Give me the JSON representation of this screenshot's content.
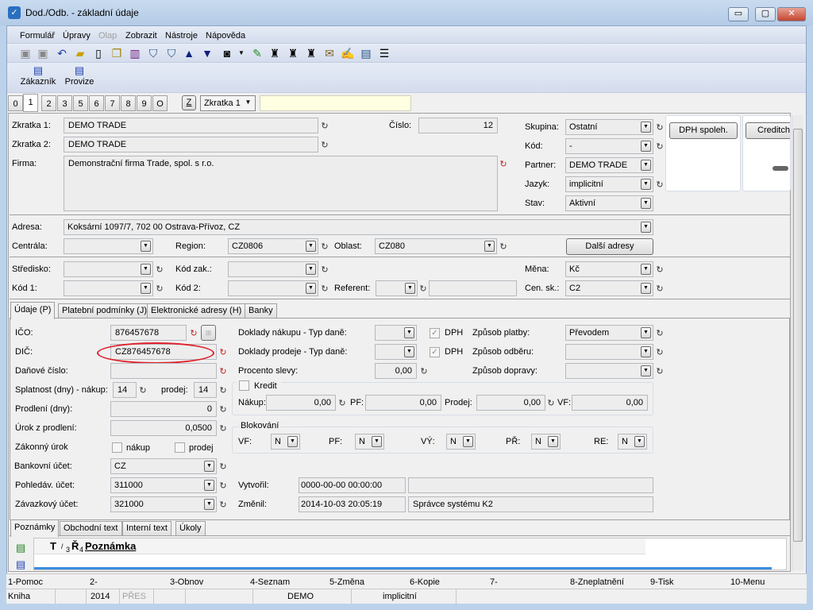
{
  "window": {
    "title": "Dod./Odb. - základní údaje",
    "minimize": "▭",
    "maximize": "▢",
    "close": "✕"
  },
  "menu": [
    "Formulář",
    "Úpravy",
    "Olap",
    "Zobrazit",
    "Nástroje",
    "Nápověda"
  ],
  "toolbar2": {
    "customer": "Zákazník",
    "commission": "Provize"
  },
  "page_tabs": [
    "0",
    "1",
    "2",
    "3",
    "5",
    "6",
    "7",
    "8",
    "9",
    "O"
  ],
  "search": {
    "z_button": "Z",
    "field": "Zkratka 1",
    "value": ""
  },
  "header": {
    "zkratka1_label": "Zkratka 1:",
    "zkratka1": "DEMO TRADE",
    "zkratka2_label": "Zkratka 2:",
    "zkratka2": "DEMO TRADE",
    "firma_label": "Firma:",
    "firma": "Demonstrační firma Trade, spol. s r.o.",
    "cislo_label": "Číslo:",
    "cislo": "12",
    "skupina_label": "Skupina:",
    "skupina": "Ostatní",
    "kod_label": "Kód:",
    "kod": "-",
    "partner_label": "Partner:",
    "partner": "DEMO TRADE",
    "jazyk_label": "Jazyk:",
    "jazyk": "implicitní",
    "stav_label": "Stav:",
    "stav": "Aktivní",
    "dph_button": "DPH spoleh.",
    "creditcheck_button": "Creditcheck"
  },
  "address": {
    "adresa_label": "Adresa:",
    "adresa": "Koksární 1097/7, 702 00  Ostrava-Přívoz, CZ",
    "centrala_label": "Centrála:",
    "centrala": "",
    "region_label": "Region:",
    "region": "CZ0806",
    "oblast_label": "Oblast:",
    "oblast": "CZ080",
    "dalsi_button": "Další adresy",
    "stredisko_label": "Středisko:",
    "stredisko": "",
    "kodzak_label": "Kód zak.:",
    "kodzak": "",
    "mena_label": "Měna:",
    "mena": "Kč",
    "kod1_label": "Kód 1:",
    "kod1": "",
    "kod2_label": "Kód 2:",
    "kod2": "",
    "referent_label": "Referent:",
    "referent": "",
    "referent_name": "",
    "censk_label": "Cen. sk.:",
    "censk": "C2"
  },
  "detail_tabs": [
    "Údaje (P)",
    "Platební podmínky (J)",
    "Elektronické adresy (H)",
    "Banky"
  ],
  "details": {
    "ico_label": "IČO:",
    "ico": "876457678",
    "dic_label": "DIČ:",
    "dic": "CZ876457678",
    "danove_label": "Daňové číslo:",
    "danove": "",
    "splatnost_label": "Splatnost (dny) - nákup:",
    "splatnost_nakup": "14",
    "prodej_label": "prodej:",
    "splatnost_prodej": "14",
    "prodleni_label": "Prodlení  (dny):",
    "prodleni": "0",
    "urok_label": "Úrok z prodlení:",
    "urok": "0,0500",
    "zakonny_label": "Zákonný úrok",
    "zakonny_nakup": "nákup",
    "zakonny_prodej": "prodej",
    "bank_label": "Bankovní účet:",
    "bank": "CZ",
    "pohledav_label": "Pohledáv. účet:",
    "pohledav": "311000",
    "zavazek_label": "Závazkový účet:",
    "zavazek": "321000",
    "nakup_typ_label": "Doklady nákupu - Typ daně:",
    "nakup_typ": "",
    "dph1": "DPH",
    "prodej_typ_label": "Doklady prodeje - Typ daně:",
    "prodej_typ": "",
    "dph2": "DPH",
    "sleva_label": "Procento slevy:",
    "sleva": "0,00",
    "platba_label": "Způsob platby:",
    "platba": "Převodem",
    "odber_label": "Způsob odběru:",
    "odber": "",
    "doprava_label": "Způsob dopravy:",
    "doprava": "",
    "kredit": {
      "label": "Kredit",
      "nakup_label": "Nákup:",
      "nakup": "0,00",
      "pf_label": "PF:",
      "pf": "0,00",
      "prodej_label": "Prodej:",
      "prodej": "0,00",
      "vf_label": "VF:",
      "vf": "0,00"
    },
    "blokovani": {
      "label": "Blokování",
      "items": [
        {
          "label": "VF:",
          "value": "N"
        },
        {
          "label": "PF:",
          "value": "N"
        },
        {
          "label": "VÝ:",
          "value": "N"
        },
        {
          "label": "PŘ:",
          "value": "N"
        },
        {
          "label": "RE:",
          "value": "N"
        }
      ]
    },
    "vytvoril_label": "Vytvořil:",
    "vytvoril_date": "0000-00-00 00:00:00",
    "vytvoril_user": "",
    "zmenil_label": "Změnil:",
    "zmenil_date": "2014-10-03 20:05:19",
    "zmenil_user": "Správce systému K2"
  },
  "note_tabs": [
    "Poznámky",
    "Obchodní text",
    "Interní text",
    "Úkoly"
  ],
  "notes": {
    "col_t": "T",
    "col_slash": "/",
    "col_3": "3",
    "col_r": "Ř",
    "col_4": "4",
    "col_note": "Poznámka"
  },
  "fkeys": [
    "1-Pomoc",
    "2-",
    "3-Obnov",
    "4-Seznam",
    "5-Změna",
    "6-Kopie",
    "7-",
    "8-Zneplatnění",
    "9-Tisk",
    "10-Menu"
  ],
  "status": {
    "book": "Kniha",
    "year": "2014",
    "mode": "PŘES",
    "company": "DEMO",
    "lang": "implicitní"
  },
  "colors": {
    "highlight_ellipse": "#e0202a",
    "title_bar": "#b9d1ea",
    "accent_line": "#3b8ee0"
  }
}
